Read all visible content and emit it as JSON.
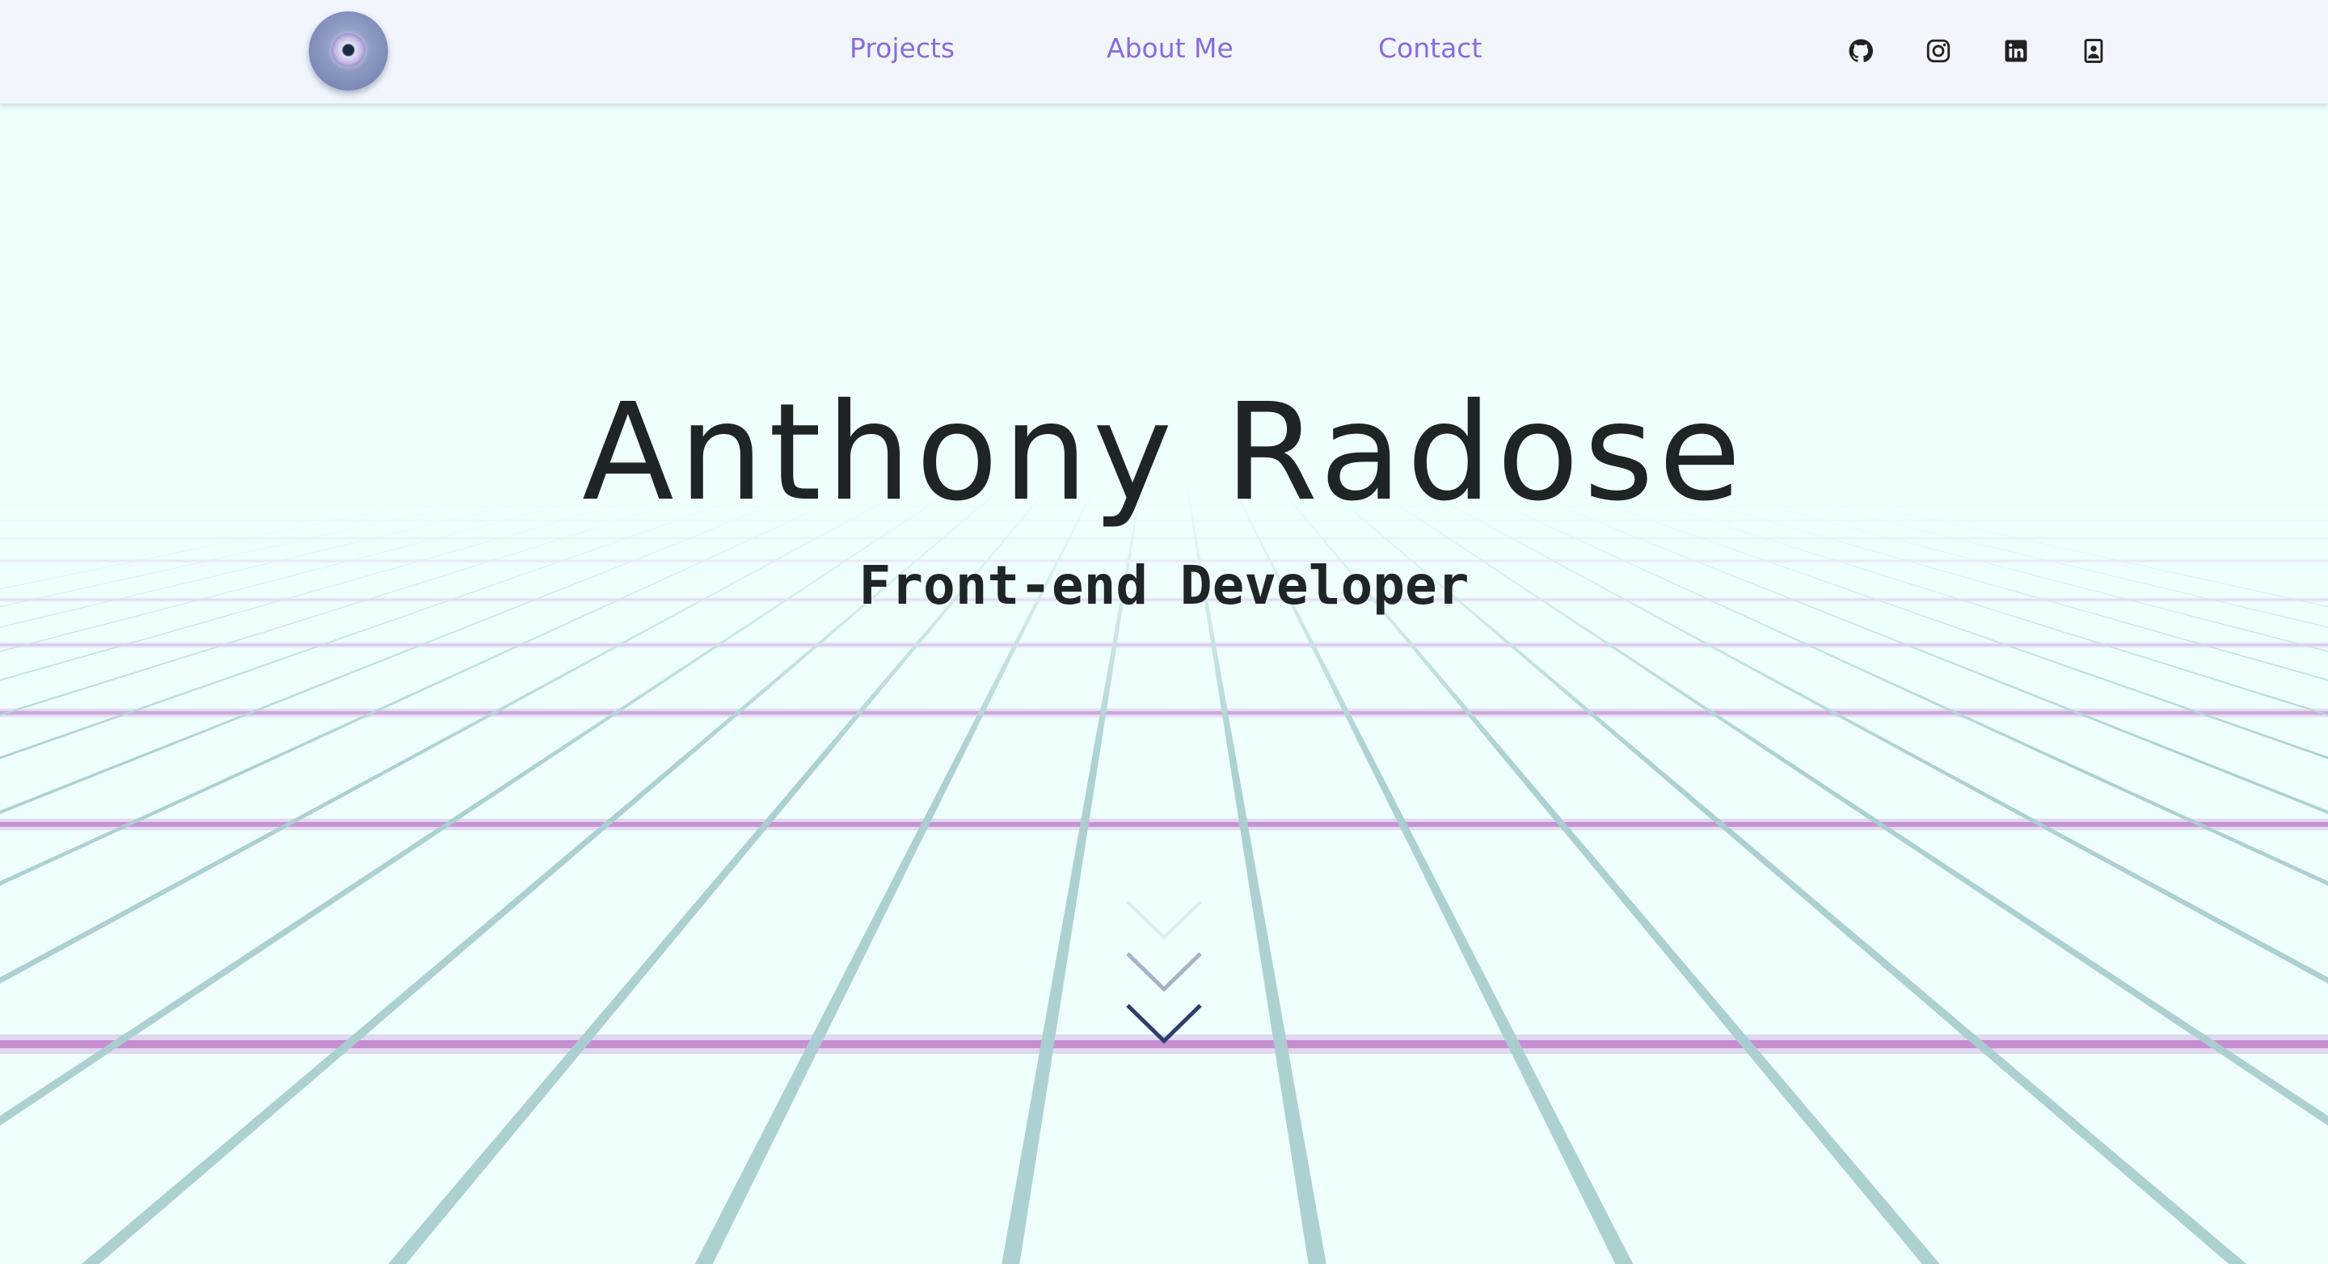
{
  "header": {
    "logo_icon": "eye-orb-logo",
    "nav": [
      {
        "label": "Projects"
      },
      {
        "label": "About Me"
      },
      {
        "label": "Contact"
      }
    ],
    "social": [
      {
        "icon": "github-icon"
      },
      {
        "icon": "instagram-icon"
      },
      {
        "icon": "linkedin-icon"
      },
      {
        "icon": "contact-card-icon"
      }
    ],
    "nav_color": "#8a6bdb"
  },
  "hero": {
    "title": "Anthony Radose",
    "subtitle": "Front-end Developer",
    "scroll_icon": "chevron-down-icon"
  },
  "colors": {
    "background": "#effffe",
    "grid_vertical": "#a9cfcf",
    "grid_horizontal": "#c48bd0",
    "text": "#1e2428"
  }
}
